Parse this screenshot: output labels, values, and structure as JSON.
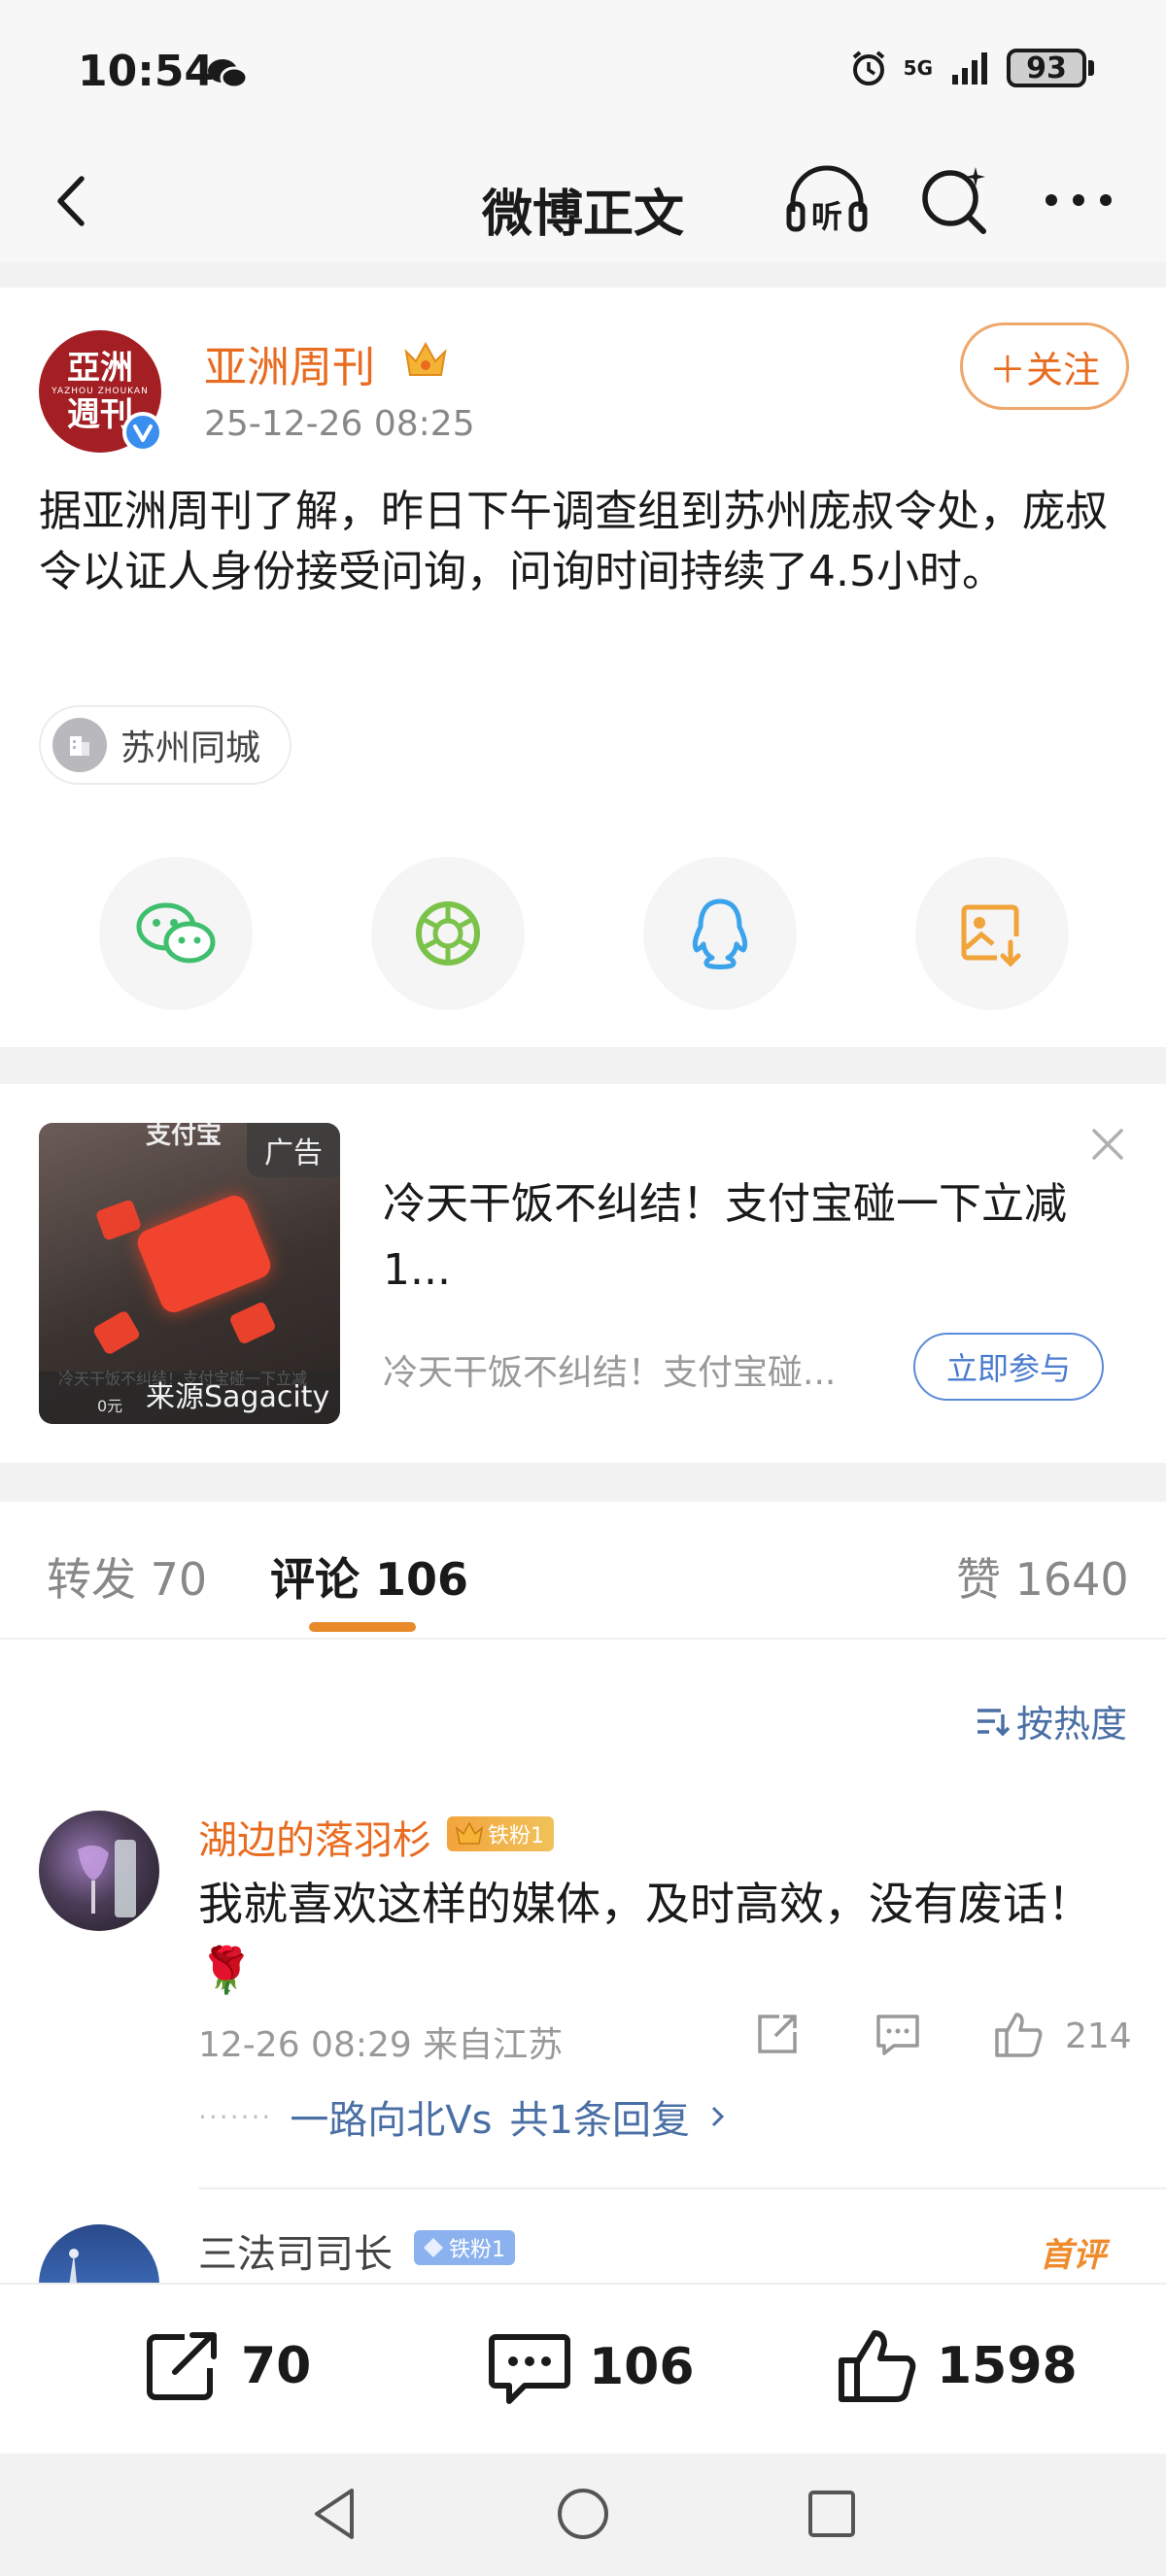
{
  "status_bar": {
    "time": "10:54",
    "network": "5G",
    "battery": "93"
  },
  "nav": {
    "title": "微博正文",
    "listen_label": "听"
  },
  "post": {
    "author": "亚洲周刊",
    "avatar_text": [
      "亞洲",
      "YAZHOU ZHOUKAN",
      "週刊"
    ],
    "time": "25-12-26 08:25",
    "follow_label": "＋关注",
    "text": "据亚洲周刊了解，昨日下午调查组到苏州庞叔令处，庞叔令以证人身份接受问询，问询时间持续了4.5小时。",
    "location": "苏州同城",
    "share_targets": [
      "wechat-icon",
      "moments-icon",
      "qq-icon",
      "save-image-icon"
    ]
  },
  "ad": {
    "tag": "广告",
    "image_top_text": "支付宝",
    "image_bottom_text": "冷天干饭不纠结！支付宝碰一下立减",
    "image_bottom_sub": "0元",
    "source": "来源Sagacity",
    "title": "冷天干饭不纠结！支付宝碰一下立减1...",
    "desc": "冷天干饭不纠结！支付宝碰...",
    "cta": "立即参与"
  },
  "tabs": [
    {
      "label": "转发",
      "count": "70"
    },
    {
      "label": "评论",
      "count": "106"
    },
    {
      "label": "赞",
      "count": "1640"
    }
  ],
  "sort_label": "按热度",
  "comments": [
    {
      "user": "湖边的落羽杉",
      "badge": "铁粉1",
      "text": "我就喜欢这样的媒体，及时高效，没有废话！🌹",
      "meta": "12-26 08:29 来自江苏",
      "likes": "214",
      "reply_user": "一路向北Vs",
      "reply_count": "共1条回复"
    },
    {
      "user": "三法司司长",
      "badge": "铁粉1",
      "first_label": "首评"
    }
  ],
  "toolbar": {
    "reposts": "70",
    "comments": "106",
    "likes": "1598"
  },
  "colors": {
    "orange": "#e86b1f",
    "blue_link": "#4a6fa5",
    "tab_underline": "#e88a2a"
  }
}
